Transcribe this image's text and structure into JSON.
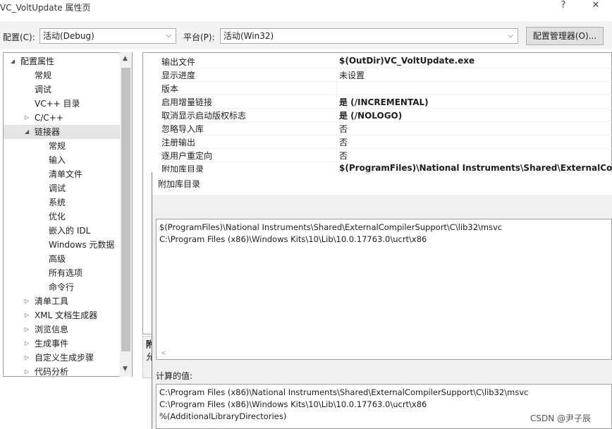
{
  "window": {
    "title": "VC_VoltUpdate 属性页",
    "help_icon": "?",
    "close_icon": "✕"
  },
  "config_bar": {
    "config_label": "配置(C):",
    "config_value": "活动(Debug)",
    "platform_label": "平台(P):",
    "platform_value": "活动(Win32)",
    "manager_button": "配置管理器(O)..."
  },
  "tree": {
    "items": [
      {
        "label": "配置属性",
        "indent": 0,
        "expander": "◢"
      },
      {
        "label": "常规",
        "indent": 1
      },
      {
        "label": "调试",
        "indent": 1
      },
      {
        "label": "VC++ 目录",
        "indent": 1
      },
      {
        "label": "C/C++",
        "indent": 1,
        "expander": "▷"
      },
      {
        "label": "链接器",
        "indent": 1,
        "expander": "◢",
        "selected": true
      },
      {
        "label": "常规",
        "indent": 2
      },
      {
        "label": "输入",
        "indent": 2
      },
      {
        "label": "清单文件",
        "indent": 2
      },
      {
        "label": "调试",
        "indent": 2
      },
      {
        "label": "系统",
        "indent": 2
      },
      {
        "label": "优化",
        "indent": 2
      },
      {
        "label": "嵌入的 IDL",
        "indent": 2
      },
      {
        "label": "Windows 元数据",
        "indent": 2
      },
      {
        "label": "高级",
        "indent": 2
      },
      {
        "label": "所有选项",
        "indent": 2
      },
      {
        "label": "命令行",
        "indent": 2
      },
      {
        "label": "清单工具",
        "indent": 1,
        "expander": "▷"
      },
      {
        "label": "XML 文档生成器",
        "indent": 1,
        "expander": "▷"
      },
      {
        "label": "浏览信息",
        "indent": 1,
        "expander": "▷"
      },
      {
        "label": "生成事件",
        "indent": 1,
        "expander": "▷"
      },
      {
        "label": "自定义生成步骤",
        "indent": 1,
        "expander": "▷"
      },
      {
        "label": "代码分析",
        "indent": 1,
        "expander": "▷"
      }
    ]
  },
  "properties": [
    {
      "name": "输出文件",
      "value": "$(OutDir)VC_VoltUpdate.exe",
      "bold": true
    },
    {
      "name": "显示进度",
      "value": "未设置",
      "bold": false
    },
    {
      "name": "版本",
      "value": "",
      "bold": false
    },
    {
      "name": "启用增量链接",
      "value": "是 (/INCREMENTAL)",
      "bold": true
    },
    {
      "name": "取消显示启动版权标志",
      "value": "是 (/NOLOGO)",
      "bold": true
    },
    {
      "name": "忽略导入库",
      "value": "否",
      "bold": false
    },
    {
      "name": "注册输出",
      "value": "否",
      "bold": false
    },
    {
      "name": "逐用户重定向",
      "value": "否",
      "bold": false
    },
    {
      "name": "附加库目录",
      "value": "$(ProgramFiles)\\National Instruments\\Shared\\ExternalCompi",
      "bold": true
    }
  ],
  "desc_panel": {
    "line1": "附",
    "line2": "允"
  },
  "dialog": {
    "title": "附加库目录",
    "lines": [
      "$(ProgramFiles)\\National Instruments\\Shared\\ExternalCompilerSupport\\C\\lib32\\msvc",
      "C:\\Program Files (x86)\\Windows Kits\\10\\Lib\\10.0.17763.0\\ucrt\\x86"
    ],
    "computed_label": "计算的值:",
    "computed_lines": [
      "C:\\Program Files (x86)\\National Instruments\\Shared\\ExternalCompilerSupport\\C\\lib32\\msvc",
      "C:\\Program Files (x86)\\Windows Kits\\10\\Lib\\10.0.17763.0\\ucrt\\x86",
      "%(AdditionalLibraryDirectories)"
    ]
  },
  "watermark": "CSDN @尹子辰"
}
